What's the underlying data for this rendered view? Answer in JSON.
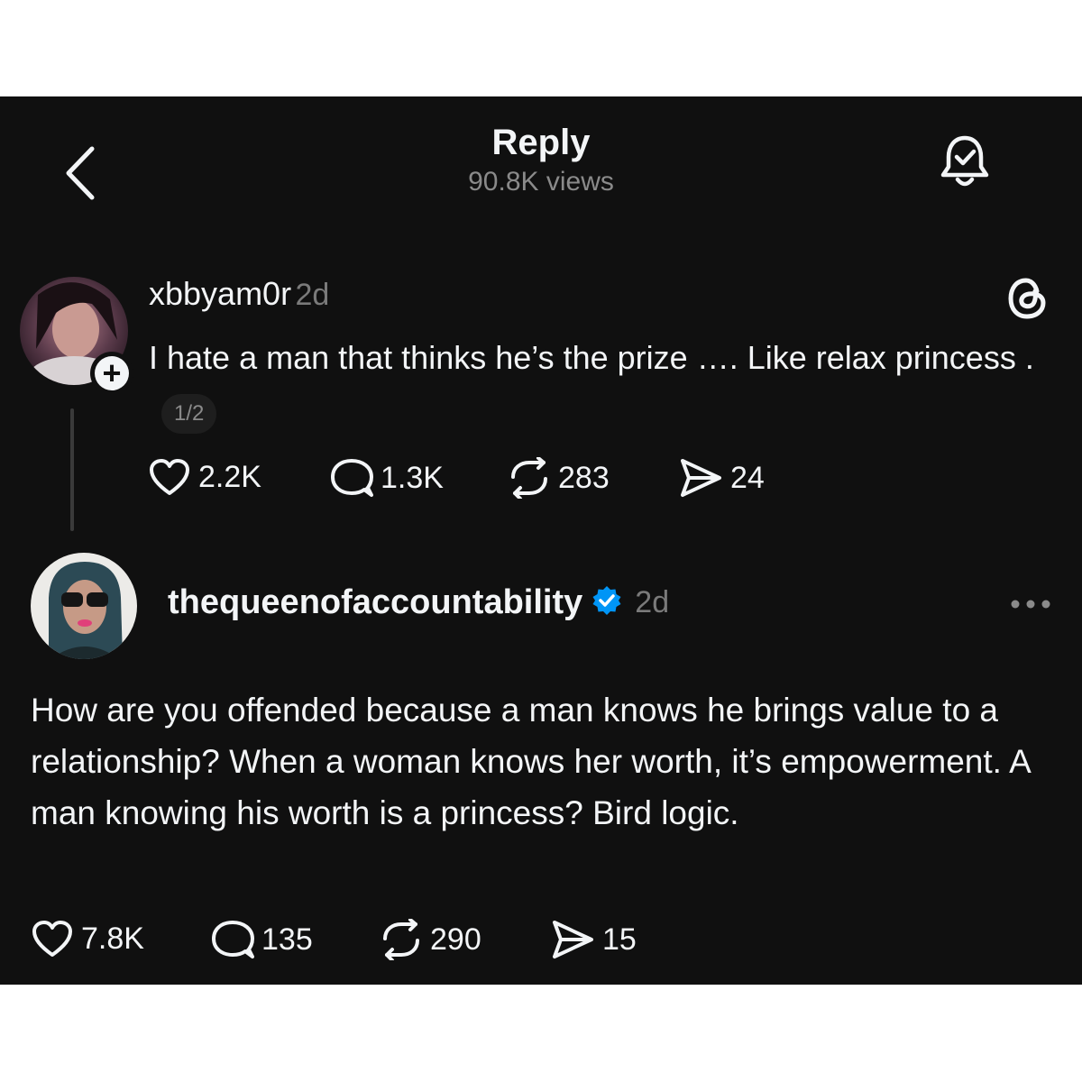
{
  "header": {
    "title": "Reply",
    "views": "90.8K views"
  },
  "original_post": {
    "username": "xbbyam0r",
    "time": "2d",
    "text": "I hate a man that thinks he’s the prize …. Like relax princess .",
    "thread_counter": "1/2",
    "likes": "2.2K",
    "comments": "1.3K",
    "reposts": "283",
    "shares": "24"
  },
  "reply": {
    "username": "thequeenofaccountability",
    "verified": true,
    "time": "2d",
    "text": "How are you offended because a man knows he brings value to a relationship? When a woman knows her worth, it’s empowerment. A man knowing his worth is a princess? Bird logic.",
    "likes": "7.8K",
    "comments": "135",
    "reposts": "290",
    "shares": "15"
  },
  "colors": {
    "background": "#101010",
    "text": "#f3f5f7",
    "muted": "#7a7a7a",
    "verified": "#0095f6"
  }
}
